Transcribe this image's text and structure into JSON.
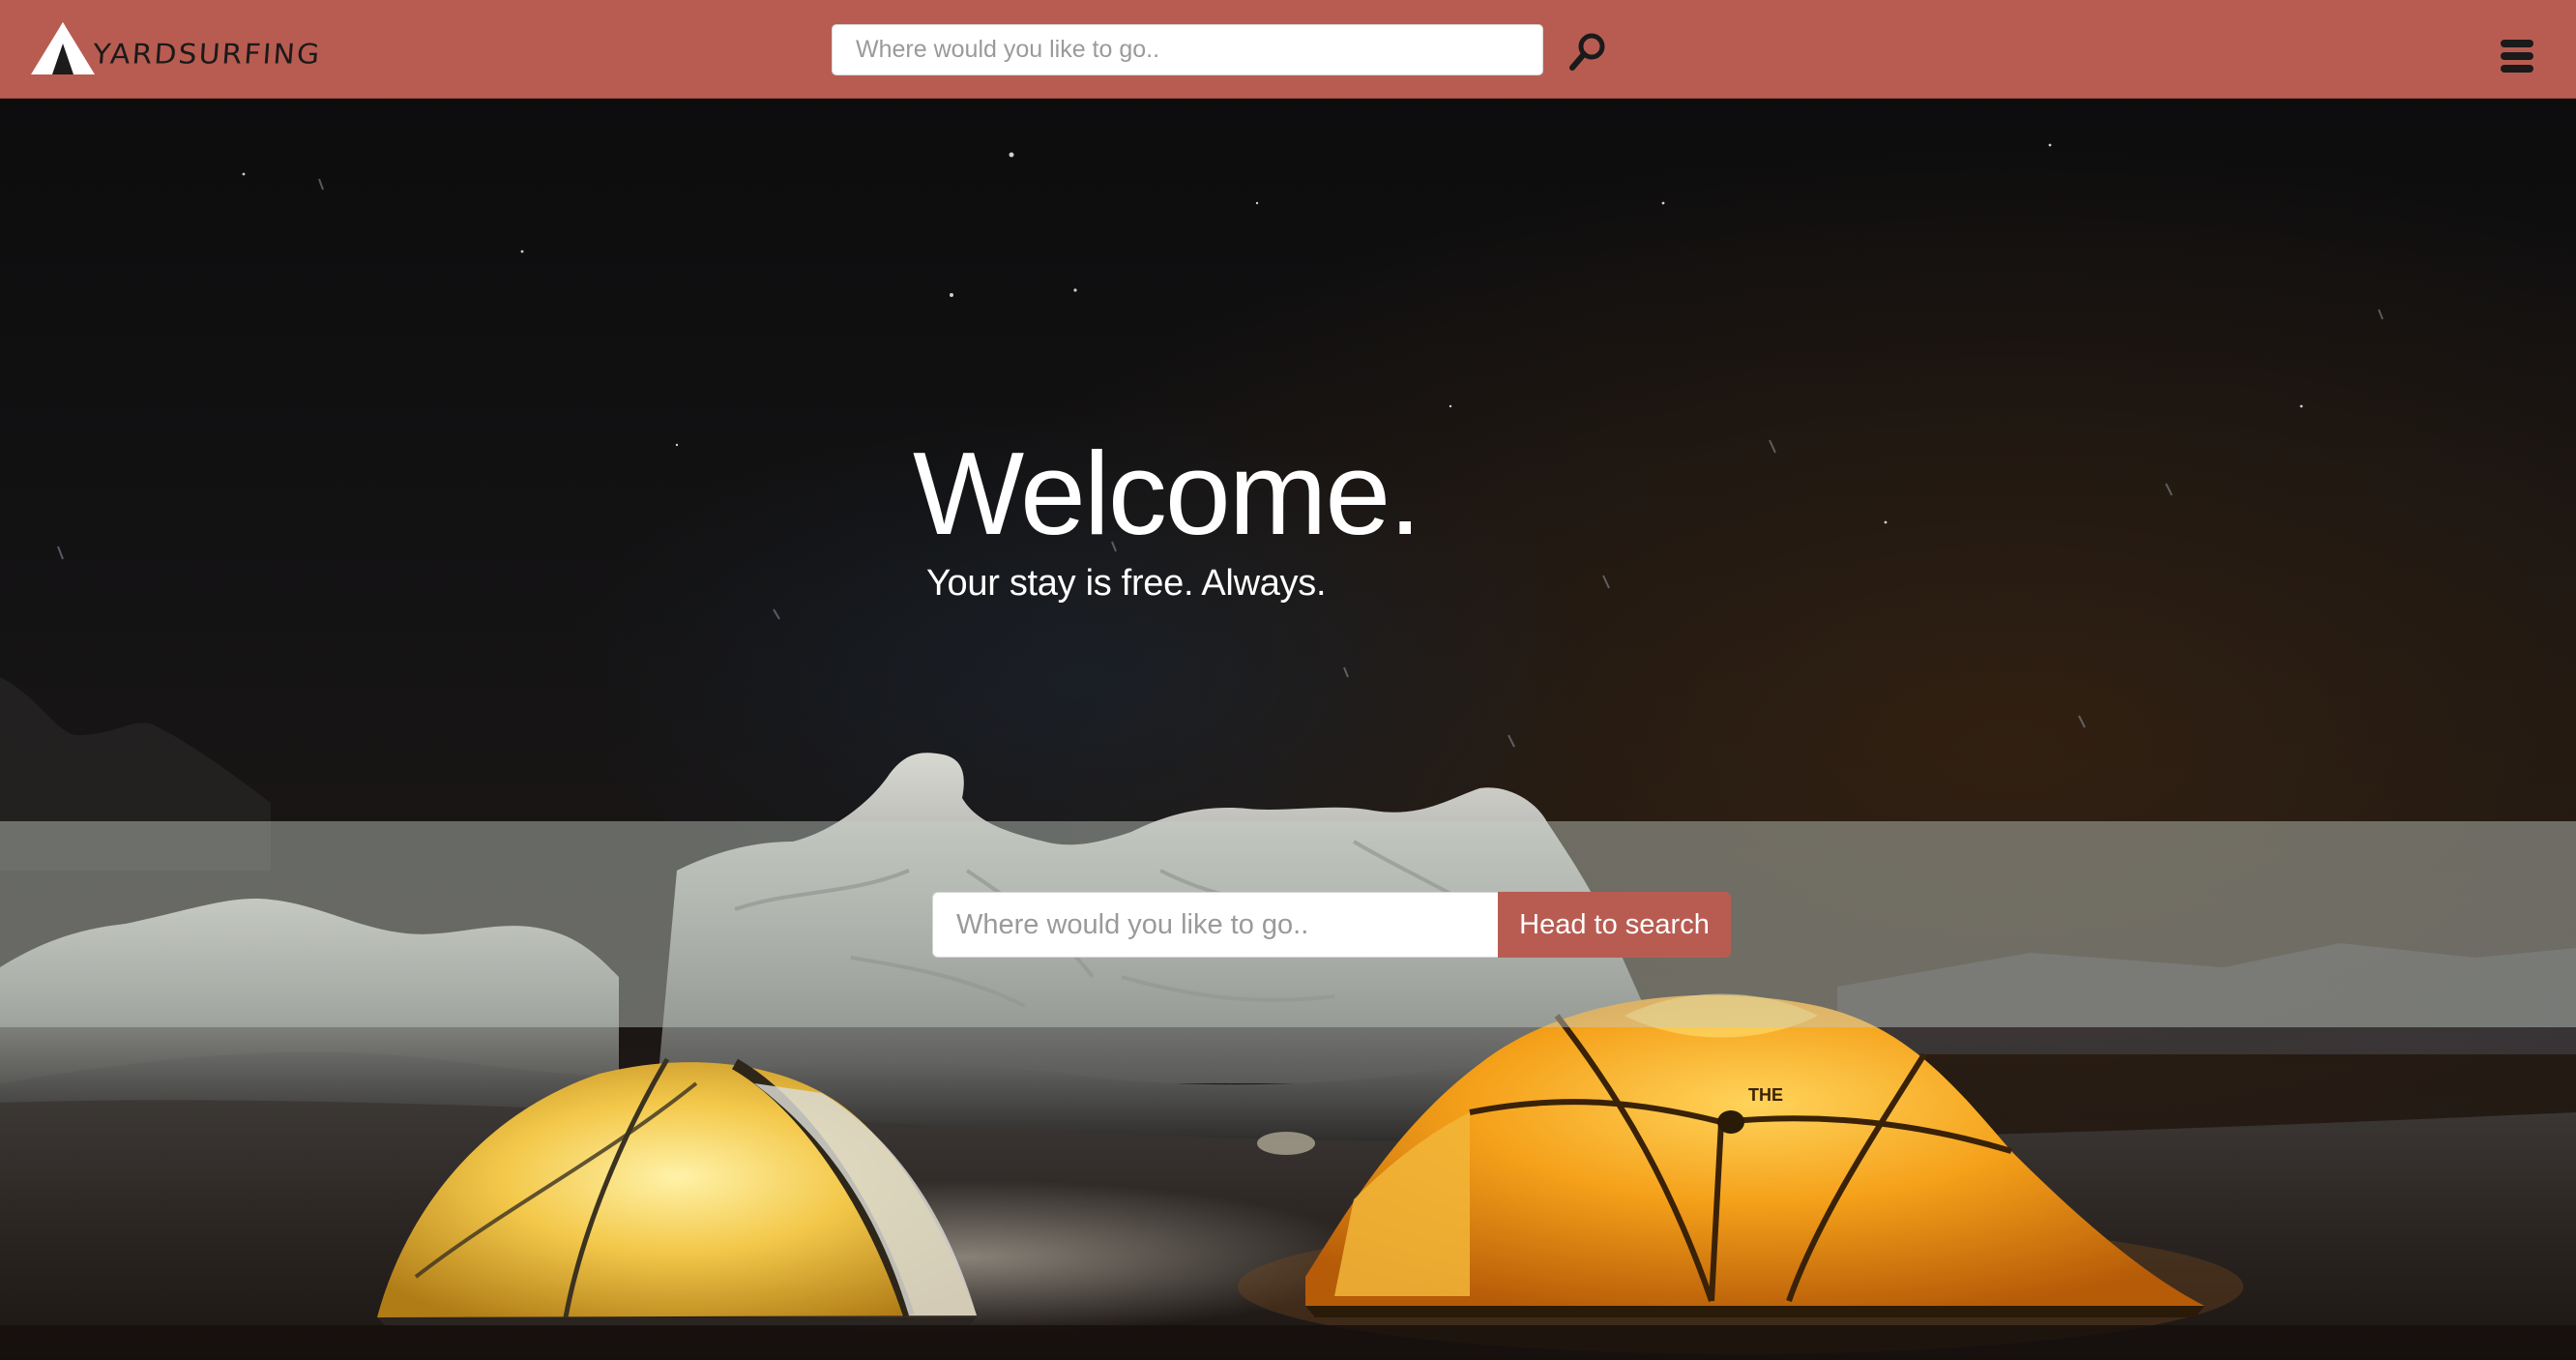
{
  "navbar": {
    "brand": "YARDSURFING",
    "search_placeholder": "Where would you like to go..",
    "search_icon": "search-icon",
    "menu_icon": "hamburger-menu-icon",
    "background_color": "#b85c52"
  },
  "hero": {
    "title": "Welcome.",
    "subtitle": "Your stay is free. Always."
  },
  "search": {
    "placeholder": "Where would you like to go..",
    "button_label": "Head to search",
    "button_color": "#b85c52"
  }
}
